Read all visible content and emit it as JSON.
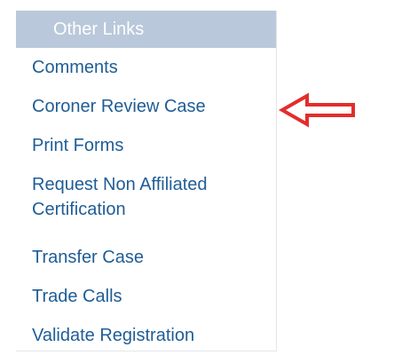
{
  "panel": {
    "header": "Other Links",
    "links": [
      {
        "label": "Comments"
      },
      {
        "label": "Coroner Review Case"
      },
      {
        "label": "Print Forms"
      },
      {
        "label": "Request Non Affiliated Certification"
      },
      {
        "label": "Transfer Case"
      },
      {
        "label": "Trade Calls"
      },
      {
        "label": "Validate Registration"
      }
    ]
  },
  "annotation": {
    "icon": "left-arrow-icon",
    "stroke_color": "#e32d2d"
  },
  "theme": {
    "header_bg": "#b9c8db",
    "header_text": "#ffffff",
    "link_color": "#1f5d96"
  }
}
